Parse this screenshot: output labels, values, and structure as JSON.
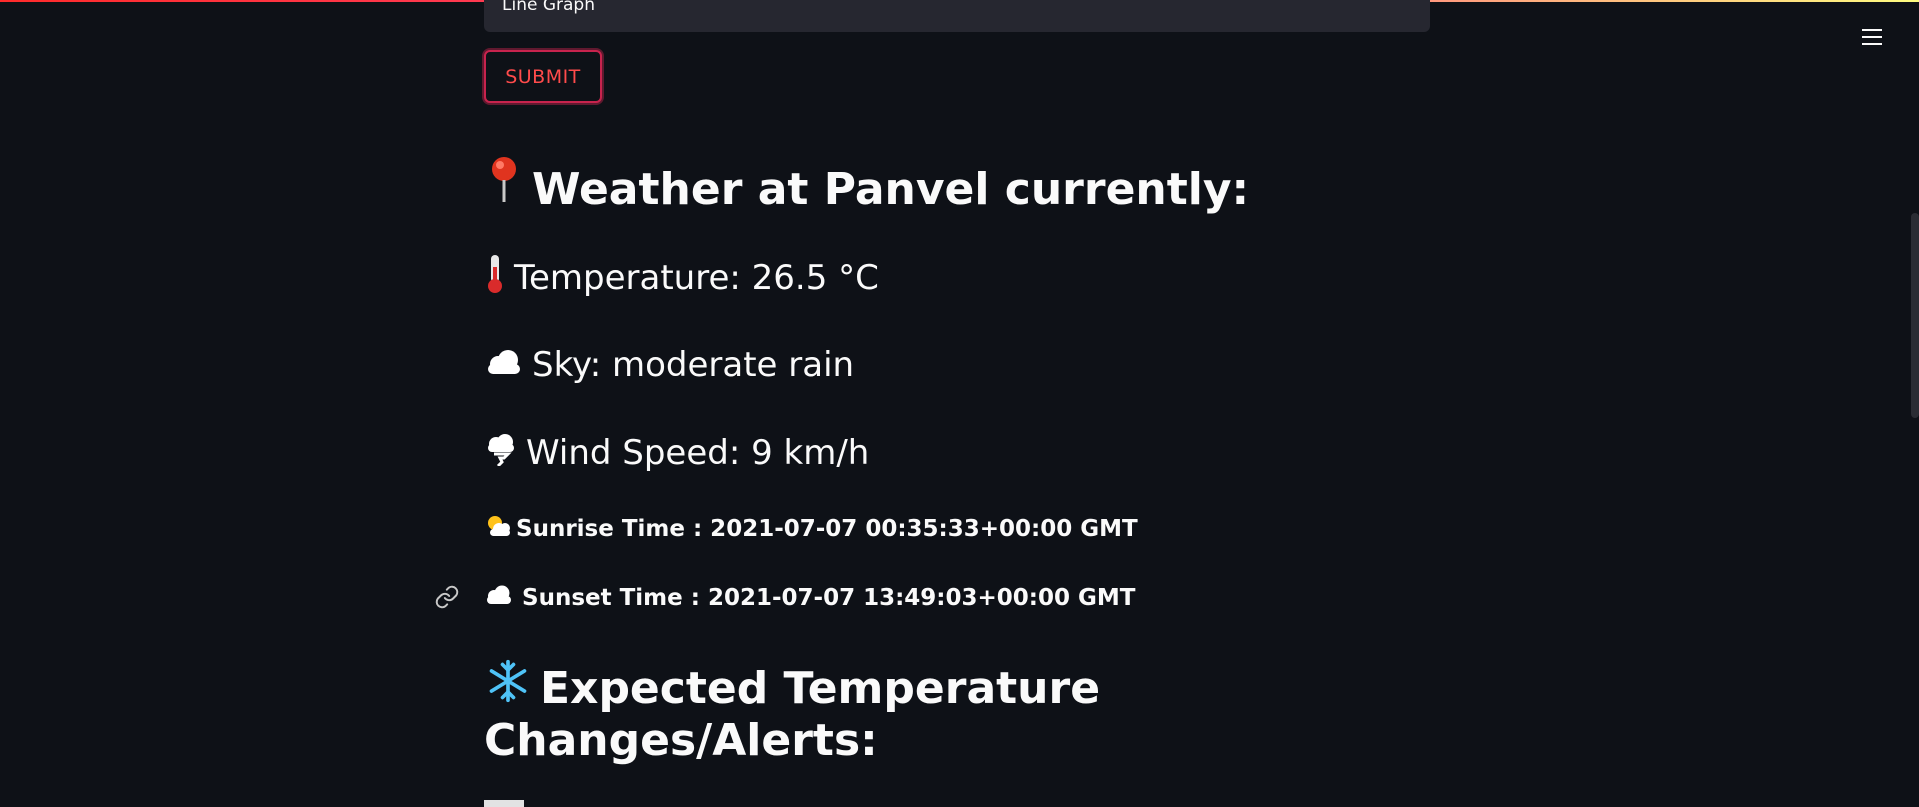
{
  "header": {
    "menu_icon": "hamburger-menu-icon"
  },
  "form": {
    "chart_select_value": "Line Graph",
    "submit_label": "SUBMIT"
  },
  "weather": {
    "heading": "Weather at Panvel currently:",
    "heading_icon": "pushpin-icon",
    "temperature": "Temperature: 26.5 °C",
    "temperature_icon": "thermometer-icon",
    "sky": "Sky: moderate rain",
    "sky_icon": "cloud-icon",
    "wind": "Wind Speed: 9 km/h",
    "wind_icon": "tornado-icon",
    "sunrise": "Sunrise Time : 2021-07-07 00:35:33+00:00 GMT",
    "sunrise_icon": "sun-behind-cloud-icon",
    "sunset": "Sunset Time : 2021-07-07 13:49:03+00:00 GMT",
    "sunset_icon": "cloud-icon"
  },
  "alerts": {
    "heading": "Expected Temperature Changes/Alerts:",
    "heading_icon": "snowflake-icon"
  },
  "colors": {
    "background": "#0e1117",
    "text": "#fafafa",
    "accent": "#ff4b4b",
    "input_bg": "#262730"
  }
}
